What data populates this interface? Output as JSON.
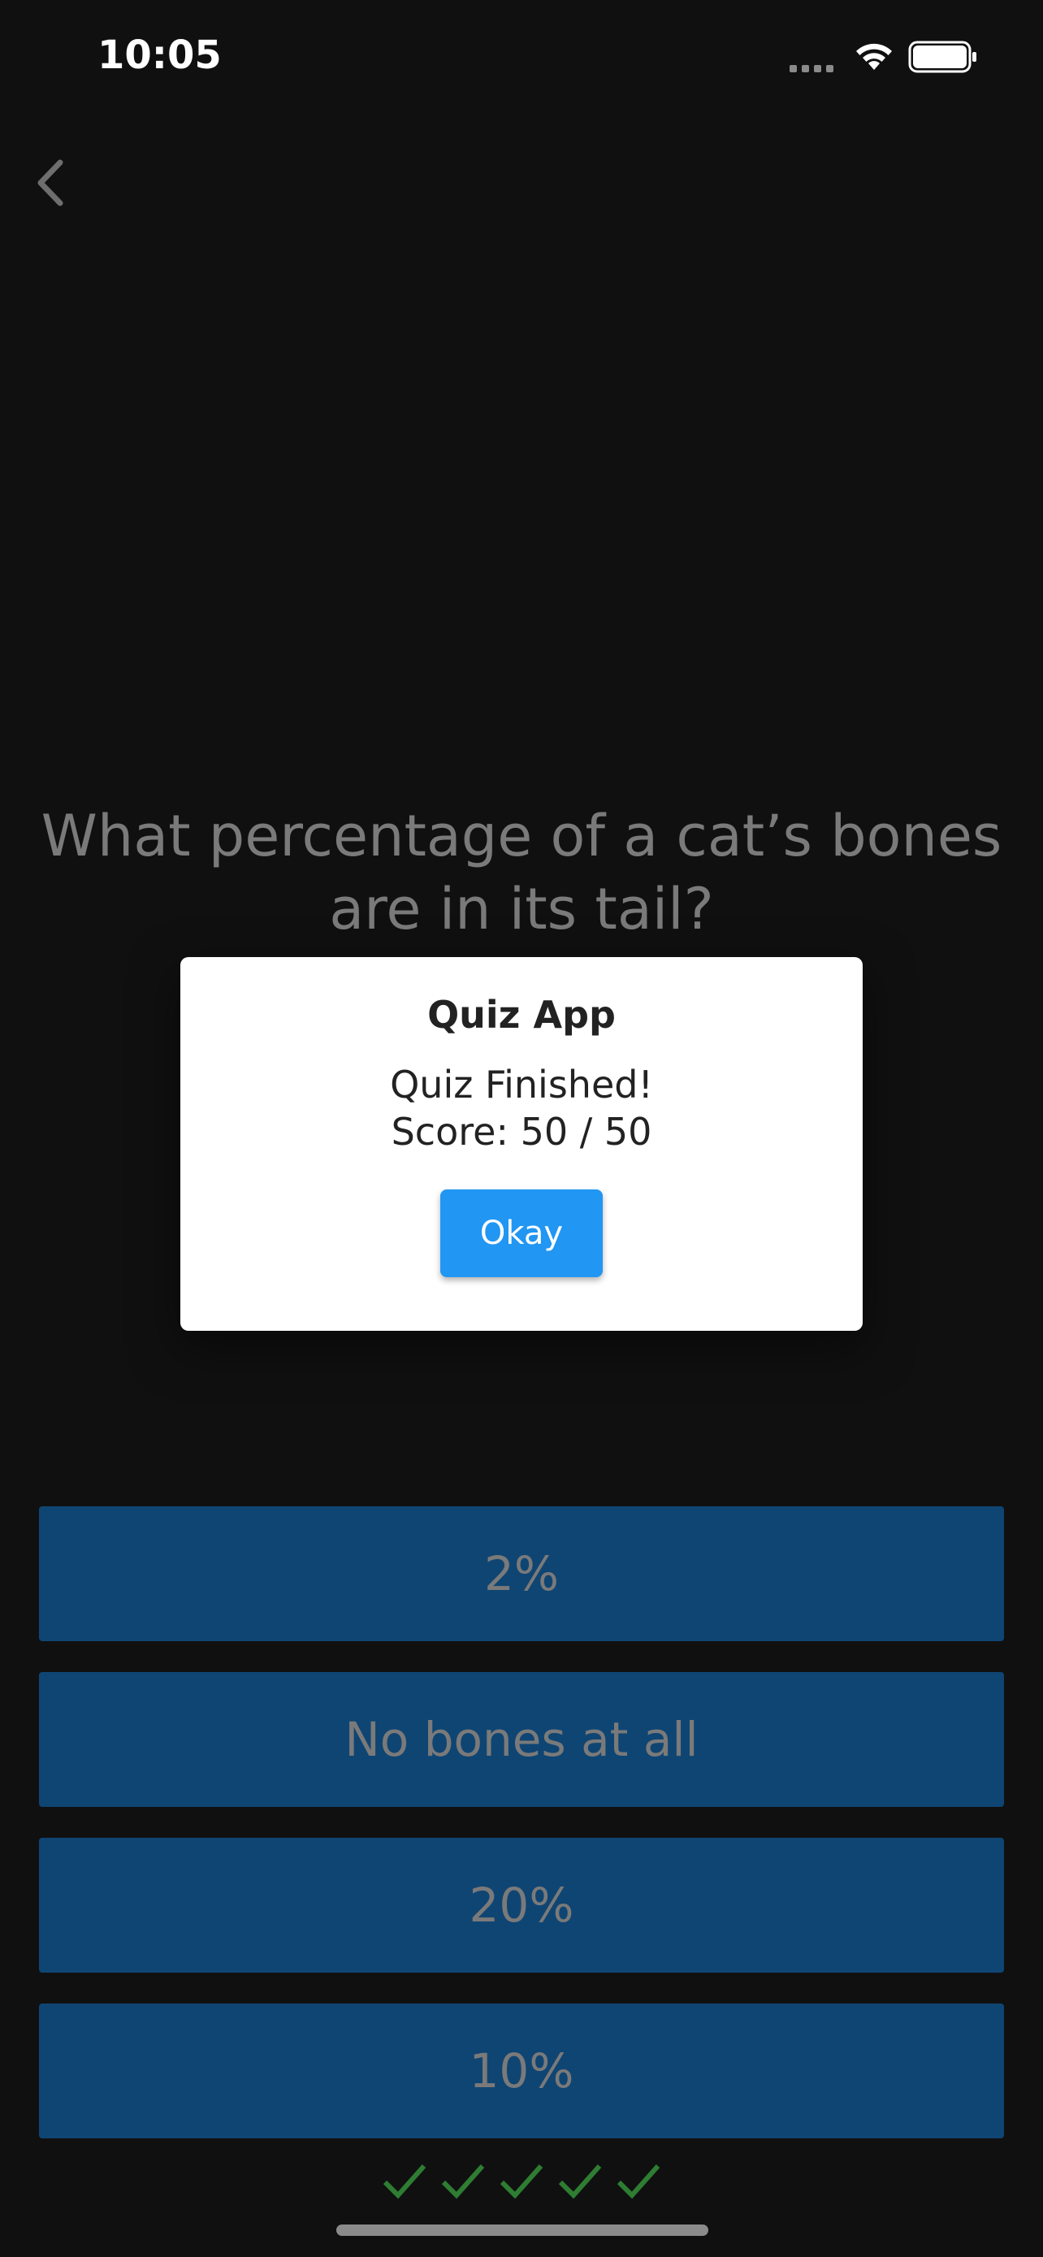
{
  "status_bar": {
    "time": "10:05"
  },
  "nav": {
    "back_icon": "chevron-left-icon"
  },
  "question": {
    "text": "What percentage of a cat’s bones are in its tail?"
  },
  "dialog": {
    "title": "Quiz App",
    "message_line1": "Quiz Finished!",
    "message_line2": "Score: 50 / 50",
    "ok_label": "Okay"
  },
  "answers": [
    {
      "label": "2%"
    },
    {
      "label": "No bones at all"
    },
    {
      "label": "20%"
    },
    {
      "label": "10%"
    }
  ],
  "score_checks": [
    "check-icon",
    "check-icon",
    "check-icon",
    "check-icon",
    "check-icon"
  ],
  "colors": {
    "background": "#101011",
    "answer_button": "#0f4573",
    "ok_button": "#2196f3",
    "check": "#2e7d32"
  }
}
